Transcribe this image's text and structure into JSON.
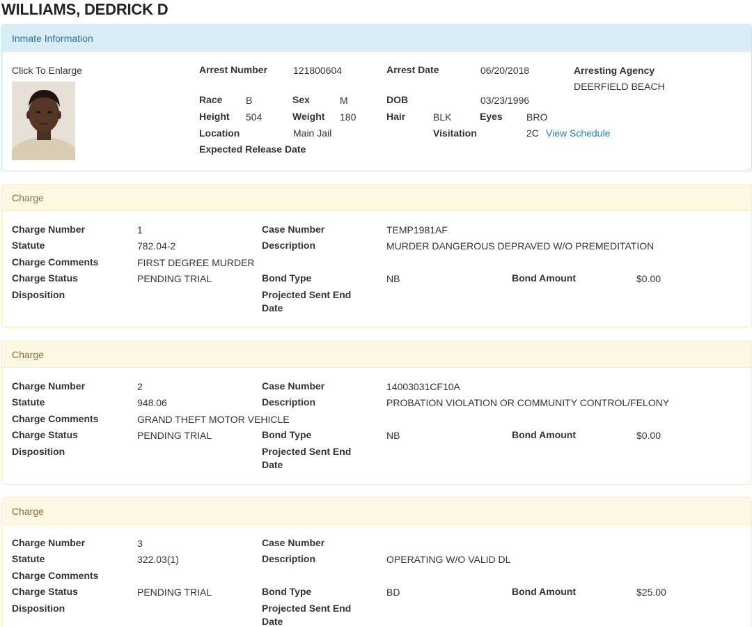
{
  "page_title": "WILLIAMS, DEDRICK D",
  "inmate": {
    "heading": "Inmate Information",
    "click_to_enlarge": "Click To Enlarge",
    "arrest_number_label": "Arrest Number",
    "arrest_number": "121800604",
    "arrest_date_label": "Arrest Date",
    "arrest_date": "06/20/2018",
    "arresting_agency_label": "Arresting Agency",
    "arresting_agency": "DEERFIELD BEACH",
    "race_label": "Race",
    "race": "B",
    "sex_label": "Sex",
    "sex": "M",
    "dob_label": "DOB",
    "dob": "03/23/1996",
    "height_label": "Height",
    "height": "504",
    "weight_label": "Weight",
    "weight": "180",
    "hair_label": "Hair",
    "hair": "BLK",
    "eyes_label": "Eyes",
    "eyes": "BRO",
    "location_label": "Location",
    "location": "Main Jail",
    "visitation_label": "Visitation",
    "visitation": "2C",
    "view_schedule": "View Schedule",
    "expected_release_label": "Expected Release Date"
  },
  "charge_labels": {
    "heading": "Charge",
    "charge_number": "Charge Number",
    "statute": "Statute",
    "charge_comments": "Charge Comments",
    "charge_status": "Charge Status",
    "disposition": "Disposition",
    "case_number": "Case Number",
    "description": "Description",
    "bond_type": "Bond Type",
    "projected_line1": "Projected Sent End",
    "projected_line2": "Date",
    "bond_amount": "Bond Amount"
  },
  "charges": [
    {
      "charge_number": "1",
      "statute": "782.04-2",
      "charge_comments": "FIRST DEGREE MURDER",
      "charge_status": "PENDING TRIAL",
      "case_number": "TEMP1981AF",
      "description": "MURDER DANGEROUS DEPRAVED W/O PREMEDITATION",
      "bond_type": "NB",
      "bond_amount": "$0.00"
    },
    {
      "charge_number": "2",
      "statute": "948.06",
      "charge_comments": "GRAND THEFT MOTOR VEHICLE",
      "charge_status": "PENDING TRIAL",
      "case_number": "14003031CF10A",
      "description": "PROBATION VIOLATION OR COMMUNITY CONTROL/FELONY",
      "bond_type": "NB",
      "bond_amount": "$0.00"
    },
    {
      "charge_number": "3",
      "statute": "322.03(1)",
      "charge_comments": "",
      "charge_status": "PENDING TRIAL",
      "case_number": "",
      "description": "OPERATING W/O VALID DL",
      "bond_type": "BD",
      "bond_amount": "$25.00"
    }
  ]
}
